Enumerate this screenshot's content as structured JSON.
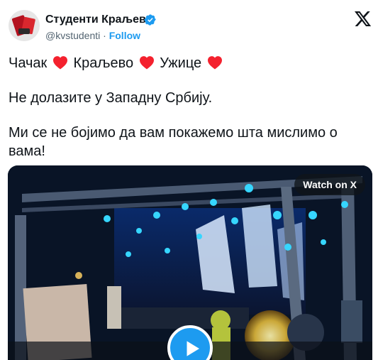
{
  "account": {
    "display_name": "Студенти Краљево",
    "handle": "@kvstudenti",
    "separator": "·",
    "follow_label": "Follow",
    "verified_color": "#1d9bf0"
  },
  "tweet": {
    "city1": "Чачак",
    "city2": "Краљево",
    "city3": "Ужице",
    "line2": "Не долазите у Западну Србију.",
    "line3": "Ми се не бојимо да вам покажемо шта мислимо о",
    "line4": "вама!",
    "heart_color": "#f4212e"
  },
  "media": {
    "watch_label": "Watch on X",
    "play_color": "#1d9bf0"
  },
  "icons": {
    "platform": "x-logo-icon",
    "verified": "verified-badge-icon",
    "heart": "red-heart-icon",
    "play": "play-icon"
  }
}
